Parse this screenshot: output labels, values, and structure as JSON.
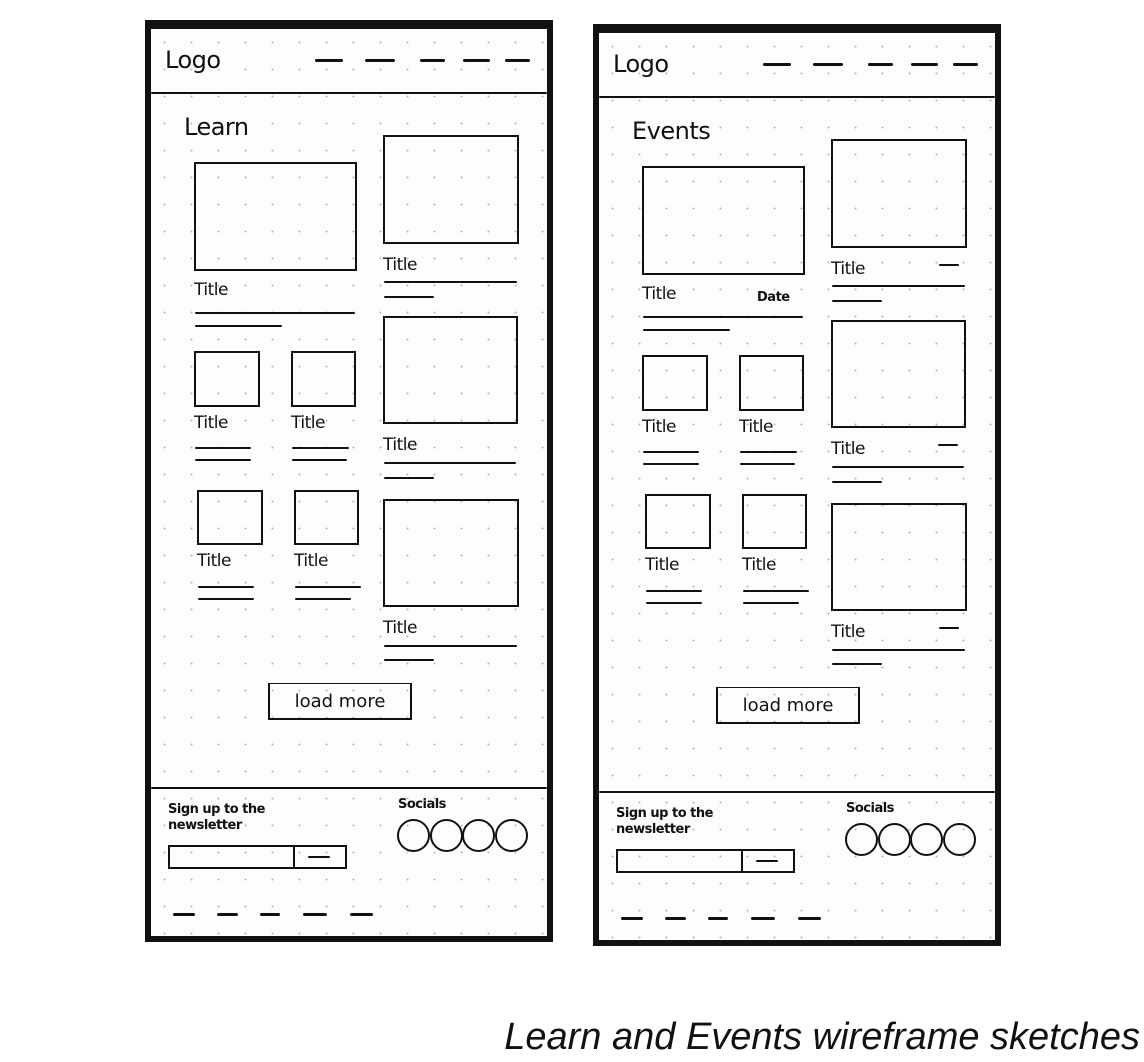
{
  "frames": [
    {
      "name": "learn",
      "logo": "Logo",
      "heading": "Learn",
      "cards": [
        {
          "title": "Title"
        },
        {
          "title": "Title"
        },
        {
          "title": "Title"
        },
        {
          "title": "Title"
        },
        {
          "title": "Title"
        },
        {
          "title": "Title"
        },
        {
          "title": "Title"
        },
        {
          "title": "Title"
        }
      ],
      "date_label": null,
      "load_more": "load more",
      "newsletter": "Sign up to the newsletter",
      "socials": "Socials",
      "social_count": 4
    },
    {
      "name": "events",
      "logo": "Logo",
      "heading": "Events",
      "cards": [
        {
          "title": "Title"
        },
        {
          "title": "Title"
        },
        {
          "title": "Title"
        },
        {
          "title": "Title"
        },
        {
          "title": "Title"
        },
        {
          "title": "Title"
        },
        {
          "title": "Title"
        },
        {
          "title": "Title"
        }
      ],
      "date_label": "Date",
      "load_more": "load more",
      "newsletter": "Sign up to the newsletter",
      "socials": "Socials",
      "social_count": 4
    }
  ],
  "caption": "Learn and Events wireframe sketches"
}
